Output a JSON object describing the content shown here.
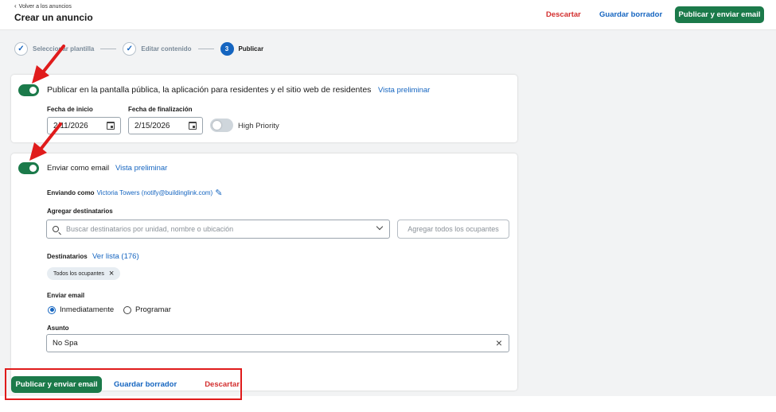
{
  "header": {
    "back_label": "Volver a los anuncios",
    "title": "Crear un anuncio",
    "discard_label": "Descartar",
    "save_draft_label": "Guardar borrador",
    "publish_label": "Publicar y enviar email"
  },
  "stepper": {
    "steps": [
      {
        "label": "Seleccionar plantilla",
        "state": "done"
      },
      {
        "label": "Editar contenido",
        "state": "done"
      },
      {
        "number": "3",
        "label": "Publicar",
        "state": "active"
      }
    ]
  },
  "public_card": {
    "toggle_label": "Publicar en la pantalla pública, la aplicación para residentes y el sitio web de residentes",
    "preview_label": "Vista preliminar",
    "start_date_label": "Fecha de inicio",
    "start_date_value": "2/11/2026",
    "end_date_label": "Fecha de finalización",
    "end_date_value": "2/15/2026",
    "high_priority_label": "High Priority",
    "public_enabled": true,
    "high_priority_enabled": false
  },
  "email_card": {
    "toggle_label": "Enviar como email",
    "preview_label": "Vista preliminar",
    "sending_as_label": "Enviando como",
    "sender": "Victoria Towers (notify@buildinglink.com)",
    "add_recipients_label": "Agregar destinatarios",
    "search_placeholder": "Buscar destinatarios por unidad, nombre o ubicación",
    "add_all_label": "Agregar todos los ocupantes",
    "recipients_label": "Destinatarios",
    "view_list_label": "Ver lista (176)",
    "chip_label": "Todos los ocupantes",
    "send_email_label": "Enviar email",
    "option_now": "Inmediatamente",
    "option_schedule": "Programar",
    "selected_option": "Inmediatamente",
    "subject_label": "Asunto",
    "subject_value": "No Spa",
    "email_enabled": true
  },
  "footer": {
    "publish_label": "Publicar y enviar email",
    "save_draft_label": "Guardar borrador",
    "discard_label": "Descartar"
  },
  "colors": {
    "primary_green": "#1b7a4a",
    "link_blue": "#1565c0",
    "discard_red": "#d32f2f",
    "annotation_red": "#e01b1b"
  },
  "icons": [
    "chevron-left-icon",
    "check-icon",
    "calendar-icon",
    "search-icon",
    "chevron-down-icon",
    "pencil-icon",
    "close-icon",
    "arrow-annotation-icon"
  ]
}
